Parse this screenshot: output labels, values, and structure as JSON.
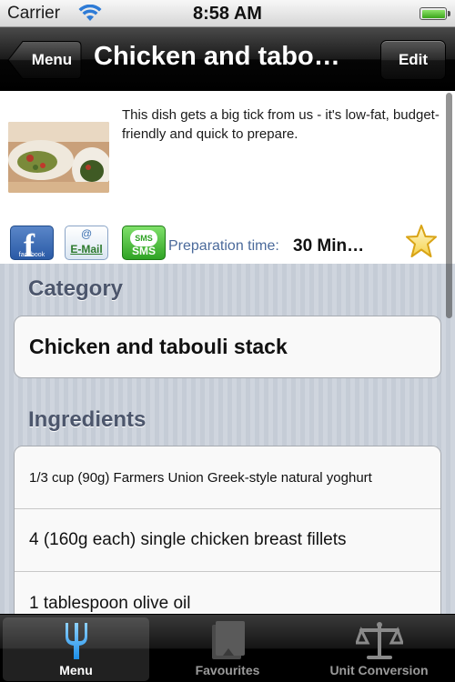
{
  "status_bar": {
    "carrier": "Carrier",
    "time": "8:58 AM"
  },
  "nav": {
    "back_label": "Menu",
    "title": "Chicken and tabo…",
    "edit_label": "Edit"
  },
  "recipe": {
    "description": "This dish gets a big tick from us - it's low-fat, budget-friendly and quick to prepare.",
    "share": {
      "facebook_icon": "facebook-icon",
      "email_icon": "email-icon",
      "email_label": "E-Mail",
      "sms_icon": "sms-icon",
      "sms_label": "SMS"
    },
    "prep_label": "Preparation time:",
    "prep_value": "30 Min…",
    "favourite_icon": "star-icon"
  },
  "category": {
    "header": "Category",
    "value": "Chicken and tabouli stack"
  },
  "ingredients": {
    "header": "Ingredients",
    "items": [
      "1/3 cup (90g) Farmers Union Greek-style natural yoghurt",
      "4 (160g each) single chicken breast fillets",
      "1 tablespoon olive oil"
    ]
  },
  "tabs": [
    {
      "label": "Menu",
      "icon": "fork-icon",
      "active": true
    },
    {
      "label": "Favourites",
      "icon": "favourites-icon",
      "active": false
    },
    {
      "label": "Unit Conversion",
      "icon": "scale-icon",
      "active": false
    }
  ],
  "colors": {
    "section_header": "#4c566c",
    "prep_label": "#4b6a9b",
    "battery": "#3aa51a"
  }
}
